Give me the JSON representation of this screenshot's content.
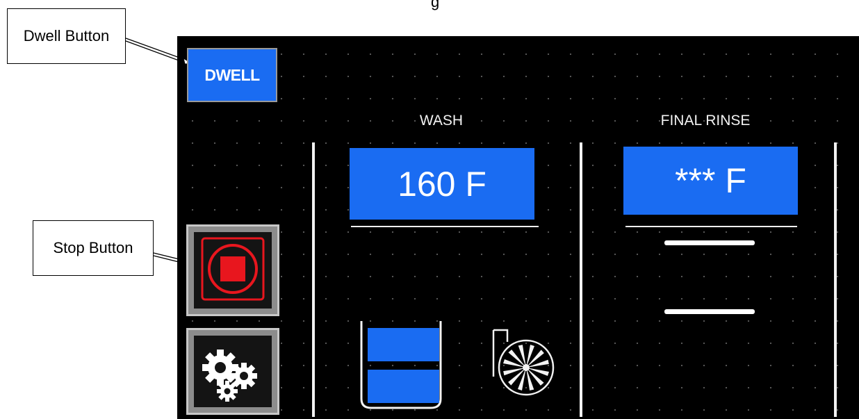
{
  "page": {
    "top_text": "g"
  },
  "callouts": {
    "dwell": "Dwell Button",
    "stop": "Stop Button"
  },
  "hmi": {
    "dwell_button": "DWELL",
    "wash": {
      "label": "WASH",
      "temperature": "160 F"
    },
    "final_rinse": {
      "label": "FINAL RINSE",
      "temperature": "*** F"
    },
    "icons": {
      "stop": "stop-icon",
      "setup": "gears-icon",
      "tank": "tank-level-icon",
      "pump": "pump-icon"
    },
    "tank_level_segments_filled": 2,
    "colors": {
      "accent_blue": "#1a6cf2",
      "stop_red": "#e8161e",
      "screen_bg": "#000000"
    }
  }
}
